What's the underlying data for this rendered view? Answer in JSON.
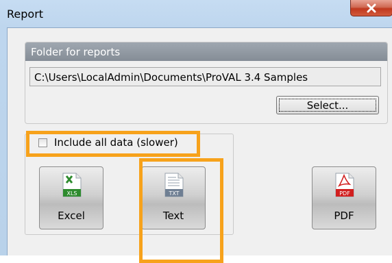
{
  "window": {
    "title": "Report"
  },
  "close_button": {
    "glyph": "x"
  },
  "folder_group": {
    "title": "Folder for reports",
    "path_value": "C:\\Users\\LocalAdmin\\Documents\\ProVAL 3.4 Samples",
    "select_label": "Select..."
  },
  "options": {
    "include_all_label": "Include all data (slower)",
    "include_all_checked": false
  },
  "exports": {
    "excel": {
      "label": "Excel",
      "badge": "XLS",
      "badge_color": "#2e8b2e"
    },
    "text": {
      "label": "Text",
      "badge": "TXT",
      "badge_color": "#6f7f93"
    },
    "pdf": {
      "label": "PDF",
      "badge": "PDF",
      "badge_color": "#d11f1f"
    }
  },
  "highlight_color": "#f7a21b"
}
